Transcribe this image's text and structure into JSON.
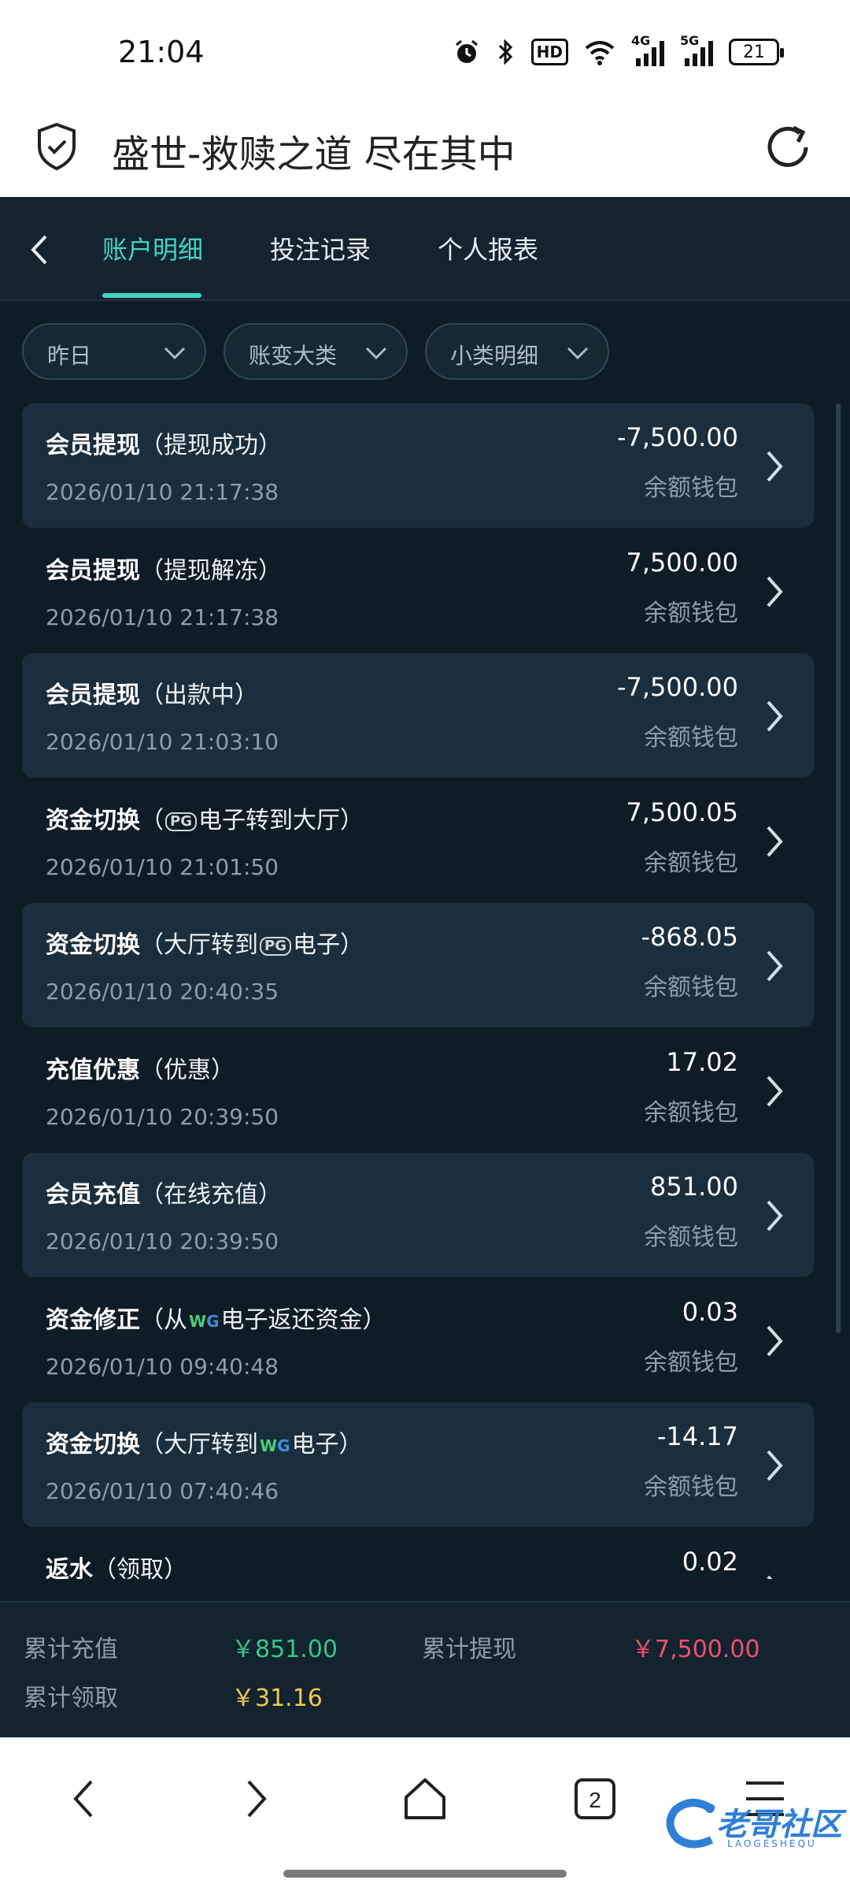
{
  "status_bar": {
    "time": "21:04",
    "hd_label": "HD",
    "net1": "4G",
    "net2": "5G",
    "battery": "21",
    "icons": [
      "alarm-icon",
      "bluetooth-icon",
      "hd-icon",
      "wifi-icon",
      "signal-4g-icon",
      "signal-5g-icon",
      "battery-icon"
    ]
  },
  "browser": {
    "page_title": "盛世-救赎之道 尽在其中",
    "tab_count": "2"
  },
  "tabs": [
    {
      "label": "账户明细",
      "active": true
    },
    {
      "label": "投注记录",
      "active": false
    },
    {
      "label": "个人报表",
      "active": false
    }
  ],
  "filters": [
    {
      "label": "昨日"
    },
    {
      "label": "账变大类"
    },
    {
      "label": "小类明细"
    }
  ],
  "records": [
    {
      "type": "会员提现",
      "prefix": "（提现成功）",
      "logo": "",
      "suffix": "",
      "date": "2026/01/10 21:17:38",
      "amount": "-7,500.00",
      "wallet": "余额钱包"
    },
    {
      "type": "会员提现",
      "prefix": "（提现解冻）",
      "logo": "",
      "suffix": "",
      "date": "2026/01/10 21:17:38",
      "amount": "7,500.00",
      "wallet": "余额钱包"
    },
    {
      "type": "会员提现",
      "prefix": "（出款中）",
      "logo": "",
      "suffix": "",
      "date": "2026/01/10 21:03:10",
      "amount": "-7,500.00",
      "wallet": "余额钱包"
    },
    {
      "type": "资金切换",
      "prefix": "（",
      "logo": "PG",
      "suffix": "电子转到大厅）",
      "date": "2026/01/10 21:01:50",
      "amount": "7,500.05",
      "wallet": "余额钱包"
    },
    {
      "type": "资金切换",
      "prefix": "（大厅转到",
      "logo": "PG",
      "suffix": "电子）",
      "date": "2026/01/10 20:40:35",
      "amount": "-868.05",
      "wallet": "余额钱包"
    },
    {
      "type": "充值优惠",
      "prefix": "（优惠）",
      "logo": "",
      "suffix": "",
      "date": "2026/01/10 20:39:50",
      "amount": "17.02",
      "wallet": "余额钱包"
    },
    {
      "type": "会员充值",
      "prefix": "（在线充值）",
      "logo": "",
      "suffix": "",
      "date": "2026/01/10 20:39:50",
      "amount": "851.00",
      "wallet": "余额钱包"
    },
    {
      "type": "资金修正",
      "prefix": "（从",
      "logo": "WG",
      "suffix": "电子返还资金）",
      "date": "2026/01/10 09:40:48",
      "amount": "0.03",
      "wallet": "余额钱包"
    },
    {
      "type": "资金切换",
      "prefix": "（大厅转到",
      "logo": "WG",
      "suffix": "电子）",
      "date": "2026/01/10 07:40:46",
      "amount": "-14.17",
      "wallet": "余额钱包"
    },
    {
      "type": "返水",
      "prefix": "（领取）",
      "logo": "",
      "suffix": "",
      "date": "",
      "amount": "0.02",
      "wallet": ""
    }
  ],
  "totals": {
    "deposit_label": "累计充值",
    "deposit_value": "￥851.00",
    "withdraw_label": "累计提现",
    "withdraw_value": "￥7,500.00",
    "claim_label": "累计领取",
    "claim_value": "￥31.16"
  },
  "colors": {
    "accent": "#3fd6c4",
    "deposit": "#33c98a",
    "withdraw": "#f0506e",
    "claim": "#f2c94c"
  },
  "watermark": {
    "text": "老哥社区",
    "sub": "LAOGESHEQU"
  }
}
